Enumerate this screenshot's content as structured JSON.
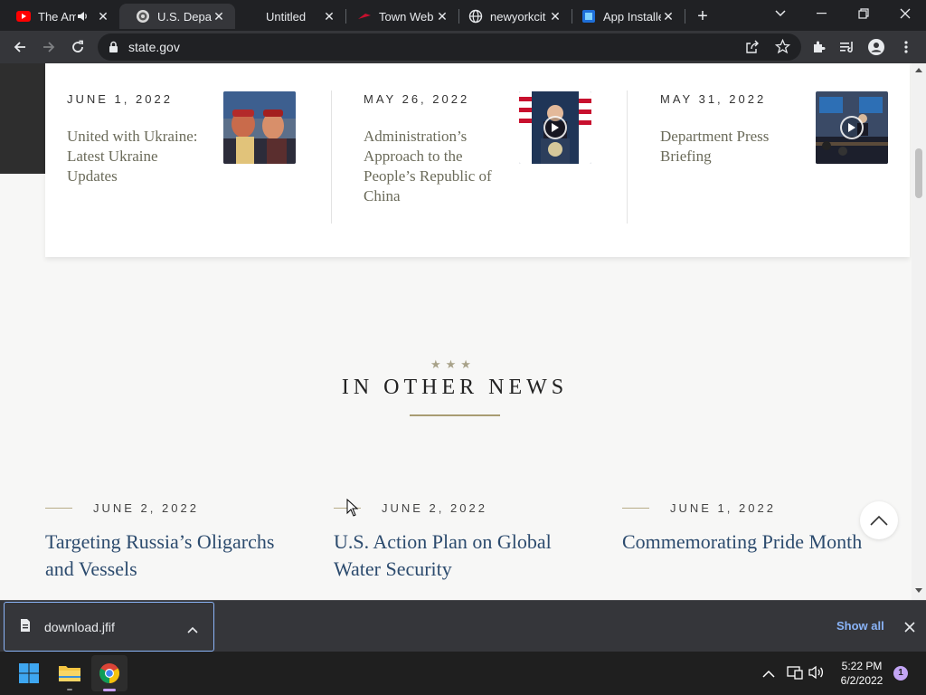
{
  "browser": {
    "tabs": [
      {
        "title": "The Am",
        "favicon": "youtube-icon",
        "audio": true,
        "active": false
      },
      {
        "title": "U.S. Depart",
        "favicon": "state-dept-seal-icon",
        "active": true
      },
      {
        "title": "Untitled",
        "favicon": "",
        "active": false
      },
      {
        "title": "Town Web",
        "favicon": "townweb-icon",
        "active": false
      },
      {
        "title": "newyorkcit",
        "favicon": "globe-icon",
        "active": false
      },
      {
        "title": "App Installe",
        "favicon": "app-installer-icon",
        "active": false
      }
    ],
    "url": "state.gov"
  },
  "page": {
    "featured": [
      {
        "date": "JUNE 1, 2022",
        "title": "United with Ukraine: Latest Ukraine Updates",
        "thumb": "ukraine-photo",
        "video": false
      },
      {
        "date": "MAY 26, 2022",
        "title": "Administration’s Approach to the People’s Republic of China",
        "thumb": "podium-photo",
        "video": true
      },
      {
        "date": "MAY 31, 2022",
        "title": "Department Press Briefing",
        "thumb": "briefing-room-photo",
        "video": true
      }
    ],
    "section": {
      "stars": "★★★",
      "heading": "IN OTHER NEWS"
    },
    "news": [
      {
        "date": "JUNE 2, 2022",
        "title": "Targeting Russia’s Oligarchs and Vessels"
      },
      {
        "date": "JUNE 2, 2022",
        "title": "U.S. Action Plan on Global Water Security"
      },
      {
        "date": "JUNE 1, 2022",
        "title": "Commemorating Pride Month"
      }
    ]
  },
  "downloads": {
    "file": "download.jfif",
    "show_all": "Show all"
  },
  "taskbar": {
    "time": "5:22 PM",
    "date": "6/2/2022",
    "notifications": "1"
  },
  "colors": {
    "accent_link": "#2c4b6e",
    "gold": "#a89c72",
    "chrome_dark": "#202124",
    "chrome_toolbar": "#35363a",
    "download_link": "#8ab4f8"
  }
}
